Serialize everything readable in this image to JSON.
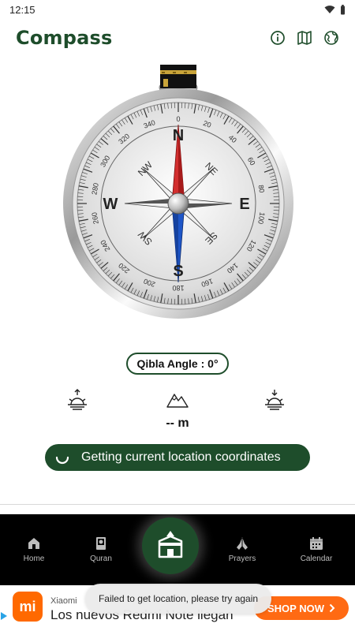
{
  "status_bar": {
    "time": "12:15"
  },
  "header": {
    "title": "Compass",
    "actions": [
      {
        "icon": "info-icon"
      },
      {
        "icon": "map-icon"
      },
      {
        "icon": "globe-icon"
      }
    ]
  },
  "compass": {
    "cardinals": {
      "n": "N",
      "e": "E",
      "s": "S",
      "w": "W"
    },
    "intercardinals": {
      "ne": "NE",
      "se": "SE",
      "sw": "SW",
      "nw": "NW"
    },
    "degree_labels": [
      "0",
      "20",
      "40",
      "60",
      "80",
      "100",
      "120",
      "140",
      "160",
      "180",
      "200",
      "220",
      "240",
      "260",
      "280",
      "300",
      "320",
      "340"
    ],
    "heading_degrees": 0,
    "kaaba_icon": "kaaba-icon"
  },
  "qibla": {
    "text": "Qibla Angle : 0°"
  },
  "info": {
    "sunrise_icon": "sunrise-icon",
    "altitude_icon": "mountain-icon",
    "sunset_icon": "sunset-icon",
    "altitude_value": "-- m"
  },
  "location_button": {
    "label": "Getting current location coordinates"
  },
  "bottom_nav": {
    "items": [
      {
        "label": "Home",
        "icon": "home-icon"
      },
      {
        "label": "Quran",
        "icon": "book-icon"
      },
      {
        "label": "",
        "icon": "kaaba-icon"
      },
      {
        "label": "Prayers",
        "icon": "prayer-hands-icon"
      },
      {
        "label": "Calendar",
        "icon": "calendar-icon"
      }
    ]
  },
  "ad": {
    "brand": "Xiaomi",
    "headline": "Los nuevos Redmi Note llegan",
    "cta": "SHOP NOW",
    "logo_text": "mi",
    "colors": {
      "accent": "#ff6a13"
    }
  },
  "toast": {
    "text": "Failed to get location, please try again"
  },
  "colors": {
    "primary": "#1e4d2b",
    "needle_north": "#d32f2f",
    "needle_south": "#1e56c8"
  }
}
